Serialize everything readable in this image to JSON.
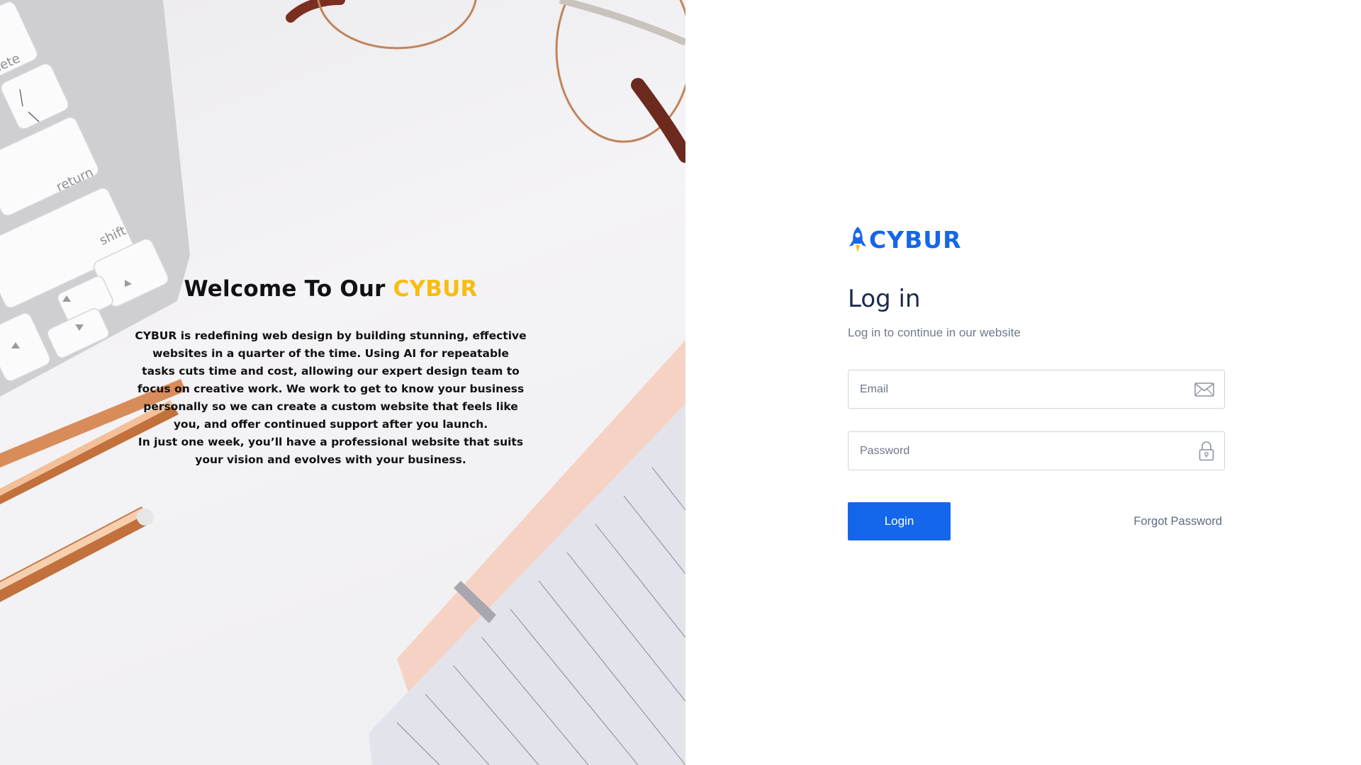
{
  "hero": {
    "title_prefix": "Welcome To Our ",
    "title_brand": "CYBUR",
    "description": "CYBUR is redefining web design by building stunning, effective websites in a quarter of the time. Using AI for repeatable tasks cuts time and cost, allowing our expert design team to focus on creative work. We work to get to know your business personally so we can create a custom website that feels like you, and offer continued support after you launch.\nIn just one week, you’ll have a professional website that suits your vision and evolves with your business.",
    "keyboard_keys": [
      "lete",
      "return",
      "shift"
    ]
  },
  "login": {
    "logo_text": "CYBUR",
    "title": "Log in",
    "subtitle": "Log in to continue in our website",
    "email_placeholder": "Email",
    "password_placeholder": "Password",
    "submit_label": "Login",
    "forgot_label": "Forgot Password"
  },
  "icons": {
    "logo_mark": "rocket-icon",
    "email": "envelope-icon",
    "password": "padlock-icon"
  },
  "colors": {
    "brand_blue": "#1466ea",
    "brand_yellow": "#f7bd10",
    "title_navy": "#1c2b4a",
    "muted_text": "#6e7b8f"
  }
}
